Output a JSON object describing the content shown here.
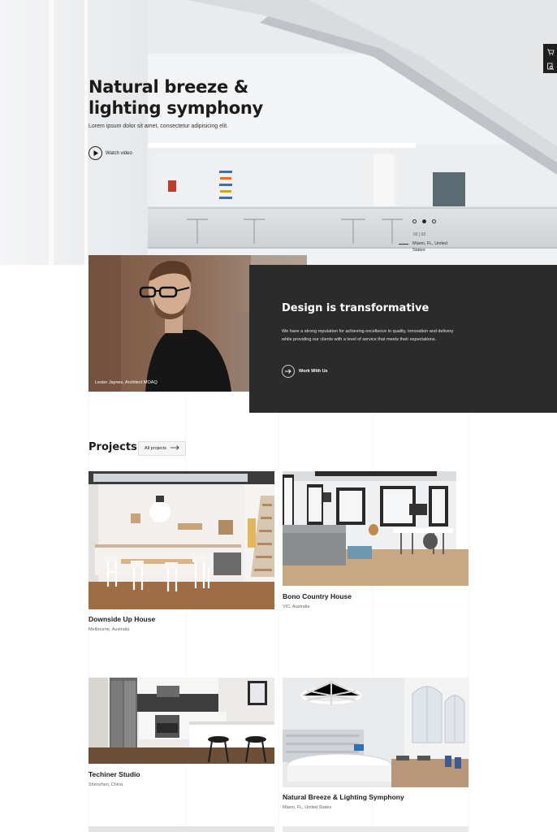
{
  "hero": {
    "title": "Natural breeze & lighting symphony",
    "subtitle": "Lorem ipsum dolor sit amet, consectetur adipisicing elit.",
    "watch_label": "Watch video",
    "counter": "02 | 03",
    "location": "Miami, FL, United States",
    "play_icon": "play-icon"
  },
  "side_widget": {
    "icons": [
      "cart-icon",
      "search-document-icon"
    ]
  },
  "intro": {
    "portrait_caption": "Lester Jaynes, Architect MOAQ",
    "heading": "Design is transformative",
    "text": "We have a strong reputation for achieving excellence in quality, innovation and delivery while providing our clients with a level of service that meets their expectations.",
    "cta_label": "Work With Us",
    "cta_icon": "arrow-right-icon"
  },
  "projects": {
    "title": "Projects",
    "all_label": "All projects",
    "items": [
      {
        "name": "Downside Up House",
        "location": "Melbourne, Australia"
      },
      {
        "name": "Bono Country House",
        "location": "VIC, Australia"
      },
      {
        "name": "Techiner Studio",
        "location": "Shenzhen, China"
      },
      {
        "name": "Natural Breeze & Lighting Symphony",
        "location": "Miami, FL, United States"
      }
    ]
  },
  "colors": {
    "dark_panel": "#2b2b2b",
    "text": "#1b1b1b",
    "background": "#ffffff"
  }
}
